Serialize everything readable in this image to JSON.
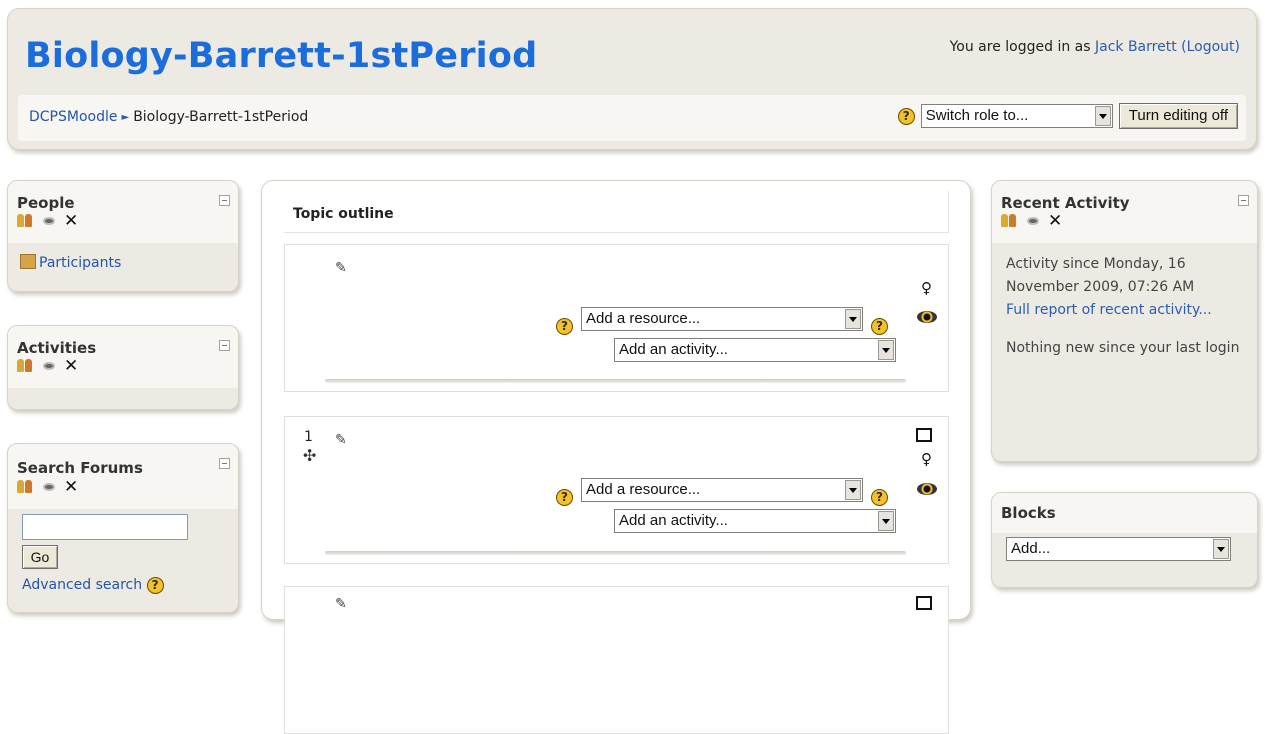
{
  "header": {
    "site_title": "Biology-Barrett-1stPeriod",
    "login_prefix": "You are logged in as ",
    "user_name": "Jack Barrett",
    "logout_label": "(Logout)",
    "breadcrumb_home": "DCPSMoodle",
    "breadcrumb_separator": "►",
    "breadcrumb_current": "Biology-Barrett-1stPeriod",
    "switch_role_value": "Switch role to...",
    "editing_button": "Turn editing off"
  },
  "left_blocks": {
    "people": {
      "title": "People",
      "participants_link": "Participants"
    },
    "activities": {
      "title": "Activities"
    },
    "search_forums": {
      "title": "Search Forums",
      "search_value": "",
      "go_label": "Go",
      "advanced_link": "Advanced search"
    }
  },
  "main": {
    "topic_outline_title": "Topic outline",
    "sections": [
      {
        "number": "",
        "add_resource": "Add a resource...",
        "add_activity": "Add an activity..."
      },
      {
        "number": "1",
        "add_resource": "Add a resource...",
        "add_activity": "Add an activity..."
      }
    ]
  },
  "right_blocks": {
    "recent_activity": {
      "title": "Recent Activity",
      "since_text": "Activity since Monday, 16 November 2009, 07:26 AM",
      "full_report_link": "Full report of recent activity...",
      "nothing_new": "Nothing new since your last login"
    },
    "blocks": {
      "title": "Blocks",
      "add_value": "Add..."
    }
  },
  "icons": {
    "help": "?",
    "close": "✕",
    "move": "✣",
    "pencil": "✎",
    "bulb": "♀"
  }
}
